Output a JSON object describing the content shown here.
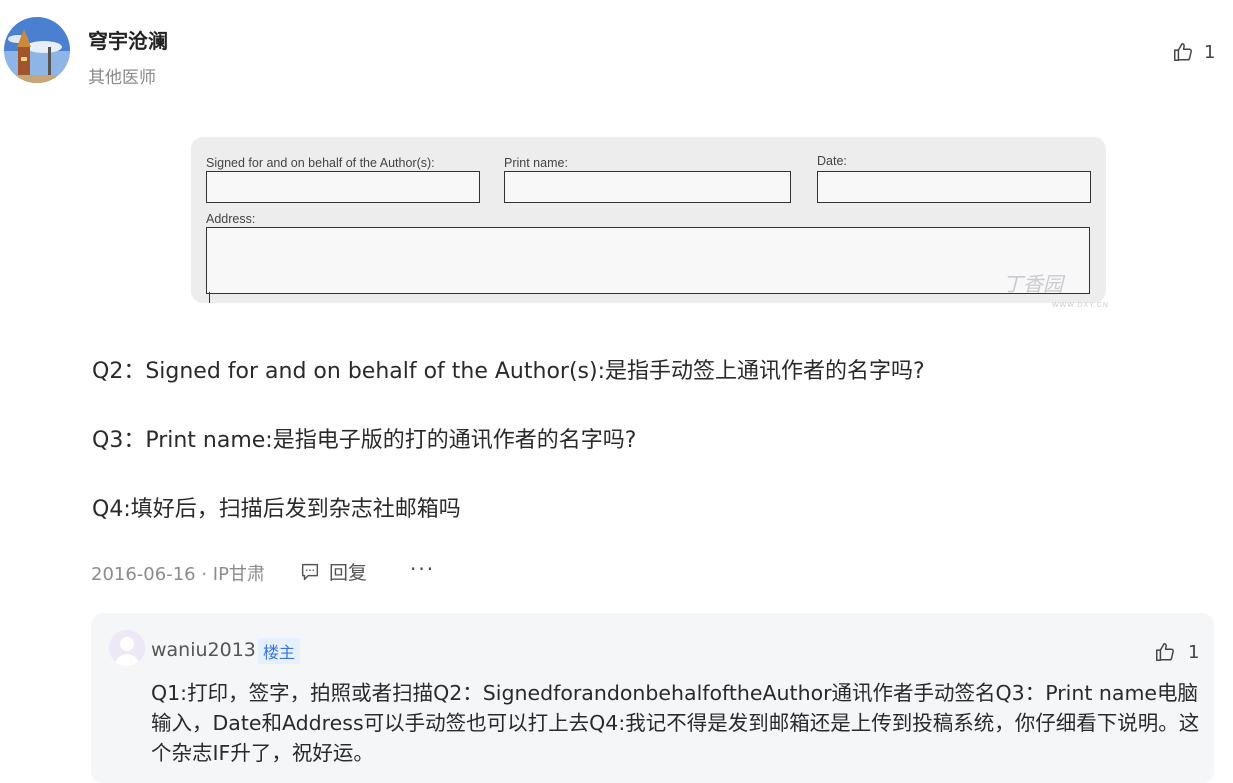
{
  "author": {
    "name": "穹宇沧澜",
    "title": "其他医师"
  },
  "post": {
    "like_count": "1",
    "form_image": {
      "label_signed": "Signed for and on behalf of the Author(s):",
      "label_print": "Print name:",
      "label_date": "Date:",
      "label_address": "Address:",
      "watermark": "丁香园",
      "watermark_url": "WWW.DXY.CN"
    },
    "questions": [
      "Q2：Signed for and on behalf of the Author(s):是指手动签上通讯作者的名字吗?",
      "Q3：Print name:是指电子版的打的通讯作者的名字吗?",
      "Q4:填好后，扫描后发到杂志社邮箱吗"
    ],
    "meta": "2016-06-16 · IP甘肃",
    "reply_label": "回复",
    "more_label": "···"
  },
  "reply": {
    "name": "waniu2013",
    "badge": "楼主",
    "like_count": "1",
    "text": "Q1:打印，签字，拍照或者扫描Q2：SignedforandonbehalfoftheAuthor通讯作者手动签名Q3：Print name电脑输入，Date和Address可以手动签也可以打上去Q4:我记不得是发到邮箱还是上传到投稿系统，你仔细看下说明。这个杂志IF升了，祝好运。"
  }
}
